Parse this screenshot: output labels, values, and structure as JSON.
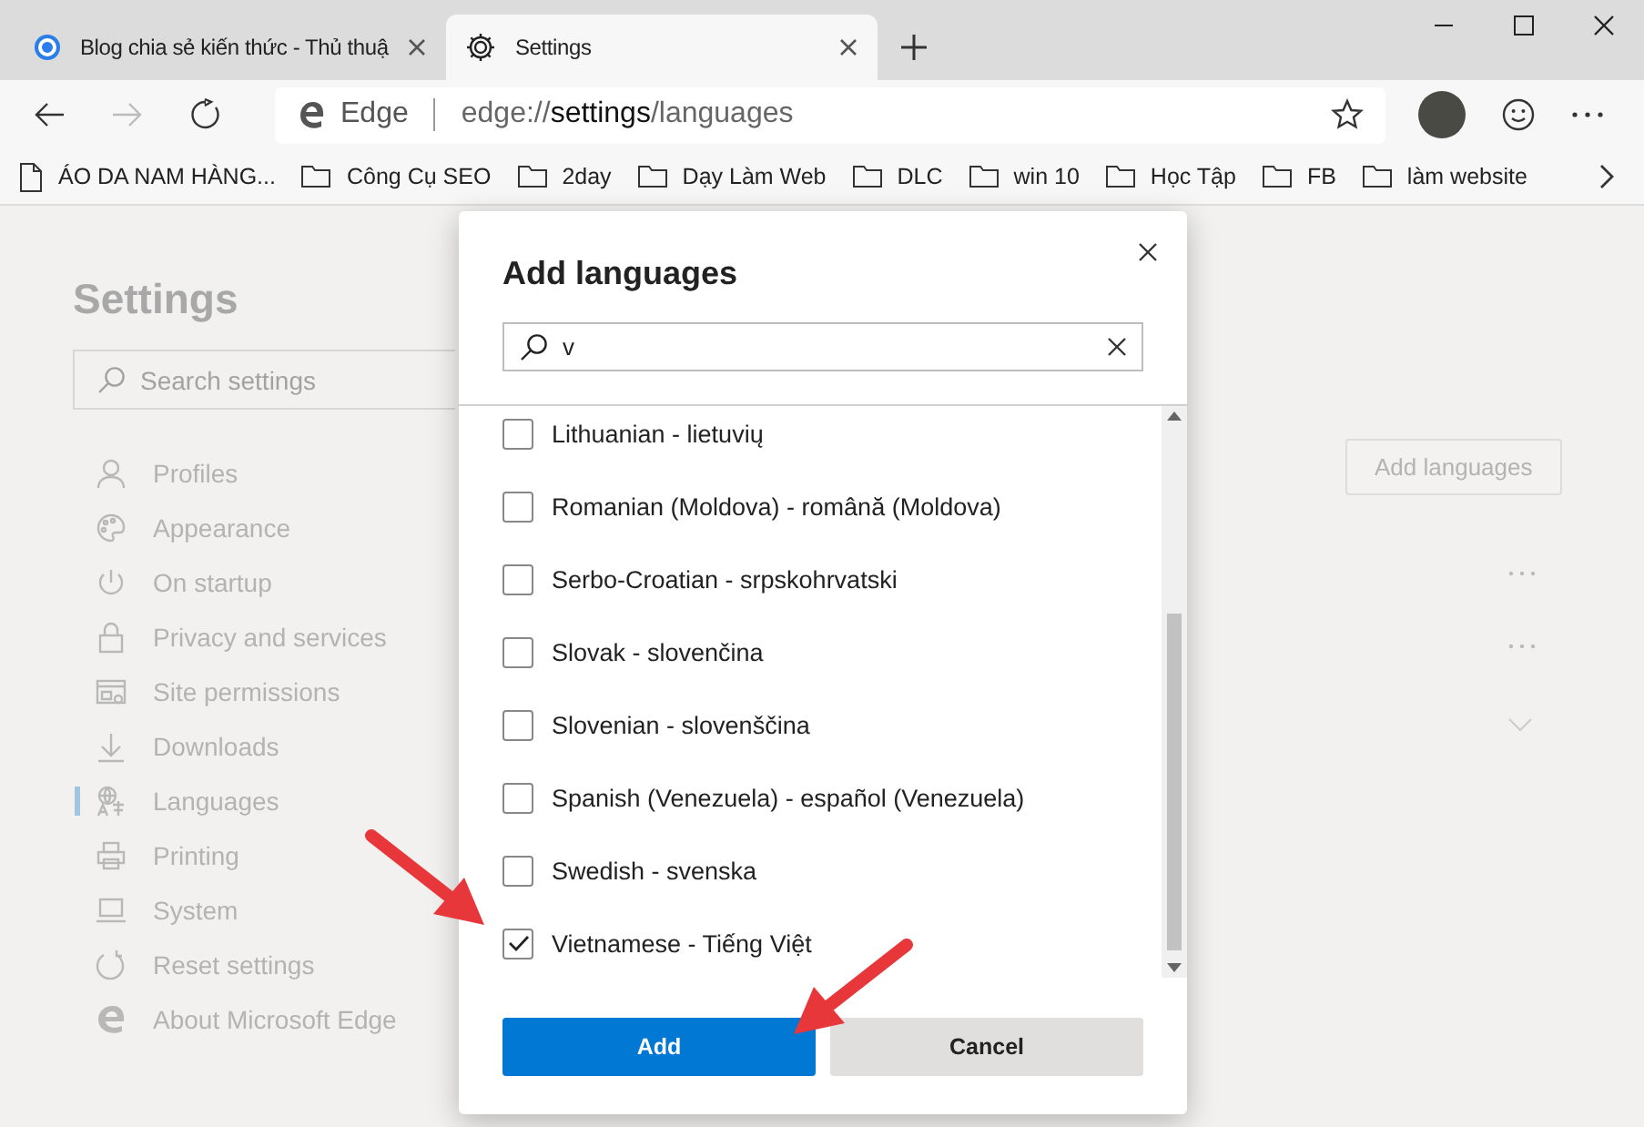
{
  "browser": {
    "tabs": [
      {
        "title": "Blog chia sẻ kiến thức - Thủ thuậ",
        "kind": "site",
        "selected": false
      },
      {
        "title": "Settings",
        "kind": "settings",
        "selected": true
      }
    ],
    "address": {
      "site_label": "Edge",
      "url": "edge://**settings**/languages"
    },
    "bookmarks": [
      {
        "label": "ÁO DA NAM HÀNG...",
        "kind": "page"
      },
      {
        "label": "Công Cụ SEO",
        "kind": "folder"
      },
      {
        "label": "2day",
        "kind": "folder"
      },
      {
        "label": "Dạy Làm Web",
        "kind": "folder"
      },
      {
        "label": "DLC",
        "kind": "folder"
      },
      {
        "label": "win 10",
        "kind": "folder"
      },
      {
        "label": "Học Tập",
        "kind": "folder"
      },
      {
        "label": "FB",
        "kind": "folder"
      },
      {
        "label": "làm website",
        "kind": "folder"
      }
    ]
  },
  "settings": {
    "title": "Settings",
    "search": {
      "placeholder": "Search settings"
    },
    "nav": [
      {
        "label": "Profiles",
        "kind": "profile",
        "selected": false
      },
      {
        "label": "Appearance",
        "kind": "palette",
        "selected": false
      },
      {
        "label": "On startup",
        "kind": "power",
        "selected": false
      },
      {
        "label": "Privacy and services",
        "kind": "lock",
        "selected": false
      },
      {
        "label": "Site permissions",
        "kind": "permissions",
        "selected": false
      },
      {
        "label": "Downloads",
        "kind": "download",
        "selected": false
      },
      {
        "label": "Languages",
        "kind": "language",
        "selected": true
      },
      {
        "label": "Printing",
        "kind": "printer",
        "selected": false
      },
      {
        "label": "System",
        "kind": "laptop",
        "selected": false
      },
      {
        "label": "Reset settings",
        "kind": "reset",
        "selected": false
      },
      {
        "label": "About Microsoft Edge",
        "kind": "edge",
        "selected": false
      }
    ],
    "add_languages_button": "Add languages"
  },
  "dialog": {
    "title": "Add languages",
    "search": {
      "value": "v"
    },
    "languages": [
      {
        "label": "Lithuanian - lietuvių",
        "checked": false
      },
      {
        "label": "Romanian (Moldova) - română (Moldova)",
        "checked": false
      },
      {
        "label": "Serbo-Croatian - srpskohrvatski",
        "checked": false
      },
      {
        "label": "Slovak - slovenčina",
        "checked": false
      },
      {
        "label": "Slovenian - slovenščina",
        "checked": false
      },
      {
        "label": "Spanish (Venezuela) - español (Venezuela)",
        "checked": false
      },
      {
        "label": "Swedish - svenska",
        "checked": false
      },
      {
        "label": "Vietnamese - Tiếng Việt",
        "checked": true
      }
    ],
    "buttons": [
      {
        "label": "Add",
        "kind": "primary"
      },
      {
        "label": "Cancel",
        "kind": "secondary"
      }
    ]
  }
}
